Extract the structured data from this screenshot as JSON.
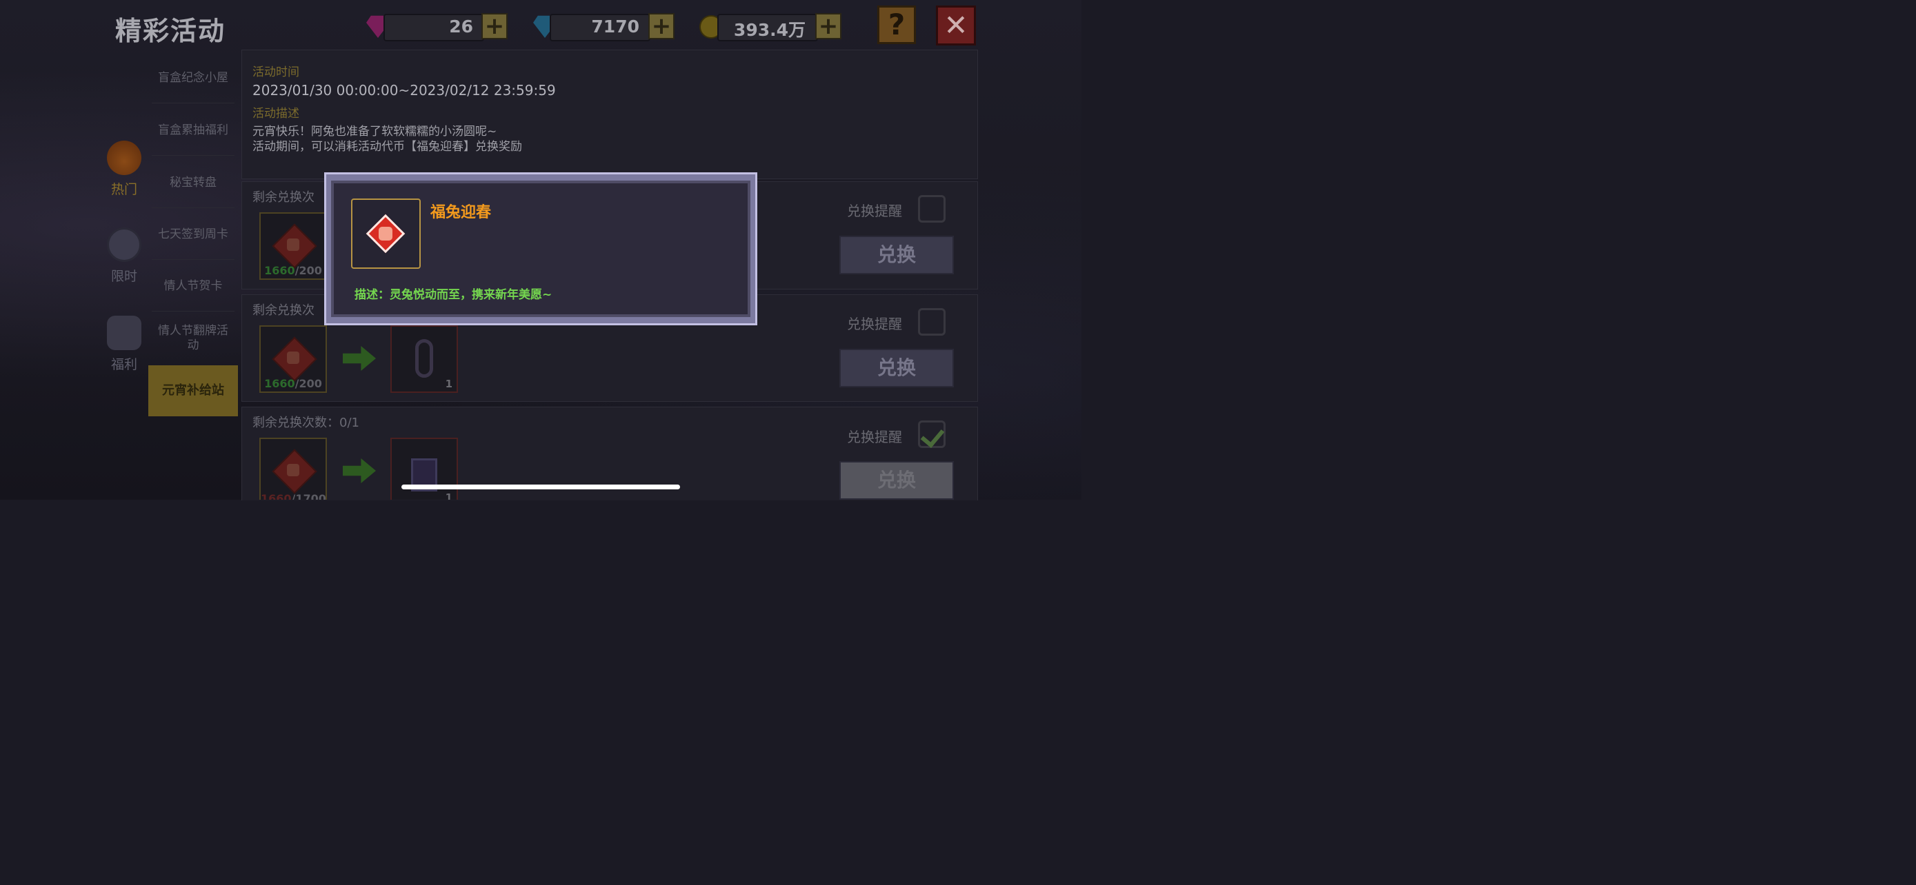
{
  "header": {
    "title": "精彩活动",
    "resources": [
      {
        "icon": "purple-gem-icon",
        "value": "26"
      },
      {
        "icon": "blue-gem-icon",
        "value": "7170"
      },
      {
        "icon": "gold-coin-icon",
        "value": "393.4万"
      }
    ],
    "plus_label": "+",
    "help_label": "?",
    "close_label": "✕"
  },
  "left_tabs": [
    {
      "icon": "fire-icon",
      "label": "热门"
    },
    {
      "icon": "clock-icon",
      "label": "限时"
    },
    {
      "icon": "gift-bag-icon",
      "label": "福利"
    }
  ],
  "menu": {
    "items": [
      "盲盒纪念小屋",
      "盲盒累抽福利",
      "秘宝转盘",
      "七天签到周卡",
      "情人节贺卡",
      "情人节翻牌活动"
    ],
    "active": "元宵补给站"
  },
  "info": {
    "time_label": "活动时间",
    "time_value": "2023/01/30 00:00:00~2023/02/12 23:59:59",
    "desc_label": "活动描述",
    "desc_line1": "元宵快乐！阿兔也准备了软软糯糯的小汤圆呢~",
    "desc_line2": "活动期间，可以消耗活动代币【福兔迎春】兑换奖励"
  },
  "cards": [
    {
      "title": "剩余兑换次",
      "have": "1660",
      "need": "/200",
      "reward_count": "",
      "remind_label": "兑换提醒",
      "checked": false,
      "button": "兑换"
    },
    {
      "title": "剩余兑换次",
      "have": "1660",
      "need": "/200",
      "reward_count": "1",
      "remind_label": "兑换提醒",
      "checked": false,
      "button": "兑换"
    },
    {
      "title": "剩余兑换次数：0/1",
      "have": "1660",
      "need": "/1700",
      "reward_count": "1",
      "remind_label": "兑换提醒",
      "checked": true,
      "button": "兑换"
    }
  ],
  "popup": {
    "item_name": "福兔迎春",
    "item_icon": "rabbit-token-icon",
    "description": "描述：灵兔悦动而至，携来新年美愿~"
  },
  "colors": {
    "popup_border": "#c3c0e3",
    "item_name": "#f39a1d",
    "description": "#74d64f",
    "active_menu": "#6b5a20"
  }
}
